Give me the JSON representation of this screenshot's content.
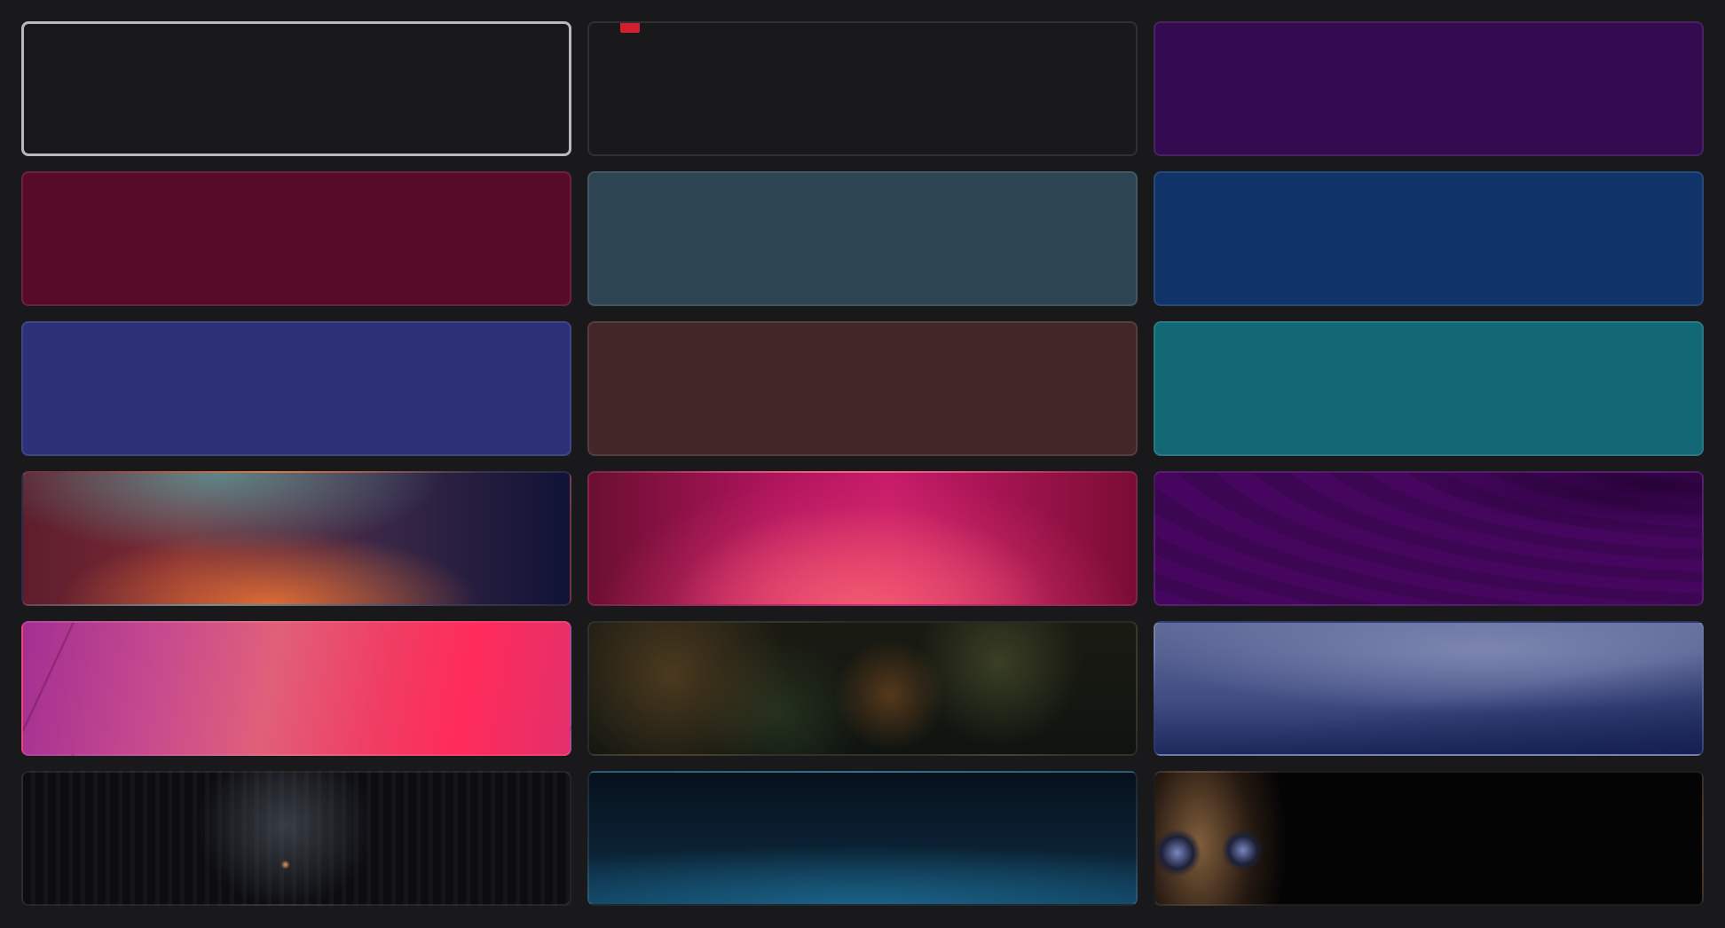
{
  "wallpaper_picker": {
    "tiles": [
      {
        "name": "wallpaper-black-selected",
        "color": "#19181b",
        "selected": true
      },
      {
        "name": "wallpaper-black-marked",
        "color": "#19181b",
        "marker": true
      },
      {
        "name": "wallpaper-purple",
        "color": "#340a50"
      },
      {
        "name": "wallpaper-crimson",
        "color": "#580b28"
      },
      {
        "name": "wallpaper-slate",
        "color": "#2d4452"
      },
      {
        "name": "wallpaper-navy",
        "color": "#10346a"
      },
      {
        "name": "wallpaper-indigo",
        "color": "#2b3077"
      },
      {
        "name": "wallpaper-brown",
        "color": "#432728"
      },
      {
        "name": "wallpaper-teal",
        "color": "#136876"
      },
      {
        "name": "wallpaper-sunset-gradient",
        "image": "grad-sunset"
      },
      {
        "name": "wallpaper-pink-gradient",
        "image": "grad-pink"
      },
      {
        "name": "wallpaper-purple-waves",
        "image": "grad-waves"
      },
      {
        "name": "wallpaper-pink-panels",
        "image": "img-panels"
      },
      {
        "name": "wallpaper-jungle-leaves",
        "image": "img-jungle"
      },
      {
        "name": "wallpaper-misty-mountains",
        "image": "img-mountains"
      },
      {
        "name": "wallpaper-dark-forest",
        "image": "img-forest"
      },
      {
        "name": "wallpaper-underwater",
        "image": "img-water"
      },
      {
        "name": "wallpaper-cat-eyes",
        "image": "img-cat"
      }
    ],
    "accent_marker_color": "#d11f2e"
  }
}
